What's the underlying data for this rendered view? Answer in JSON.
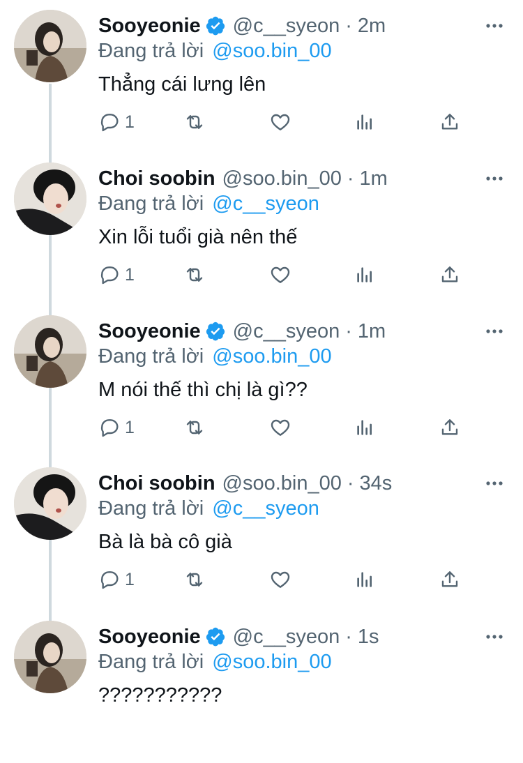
{
  "tweets": [
    {
      "name": "Sooyeonie",
      "verified": true,
      "handle": "@c__syeon",
      "dot": "·",
      "time": "2m",
      "reply_prefix": "Đang trả lời",
      "reply_to": "@soo.bin_00",
      "text": "Thẳng cái lưng lên",
      "reply_count": "1",
      "avatar": "sooyeonie"
    },
    {
      "name": "Choi soobin",
      "verified": false,
      "handle": "@soo.bin_00",
      "dot": "·",
      "time": "1m",
      "reply_prefix": "Đang trả lời",
      "reply_to": "@c__syeon",
      "text": "Xin lỗi tuổi già nên thế",
      "reply_count": "1",
      "avatar": "soobin"
    },
    {
      "name": "Sooyeonie",
      "verified": true,
      "handle": "@c__syeon",
      "dot": "·",
      "time": "1m",
      "reply_prefix": "Đang trả lời",
      "reply_to": "@soo.bin_00",
      "text": "M nói thế thì chị là gì??",
      "reply_count": "1",
      "avatar": "sooyeonie"
    },
    {
      "name": "Choi soobin",
      "verified": false,
      "handle": "@soo.bin_00",
      "dot": "·",
      "time": "34s",
      "reply_prefix": "Đang trả lời",
      "reply_to": "@c__syeon",
      "text": "Bà là bà cô già",
      "reply_count": "1",
      "avatar": "soobin"
    },
    {
      "name": "Sooyeonie",
      "verified": true,
      "handle": "@c__syeon",
      "dot": "·",
      "time": "1s",
      "reply_prefix": "Đang trả lời",
      "reply_to": "@soo.bin_00",
      "text": "???????????",
      "reply_count": "",
      "avatar": "sooyeonie"
    }
  ],
  "icons": {
    "verified": "verified-badge-icon",
    "more": "more-dots-icon",
    "reply": "reply-bubble-icon",
    "retweet": "retweet-icon",
    "like": "heart-icon",
    "analytics": "analytics-bars-icon",
    "share": "share-upload-icon"
  },
  "colors": {
    "accent": "#1d9bf0",
    "secondary_text": "#536471",
    "thread_line": "#cfd9de"
  }
}
